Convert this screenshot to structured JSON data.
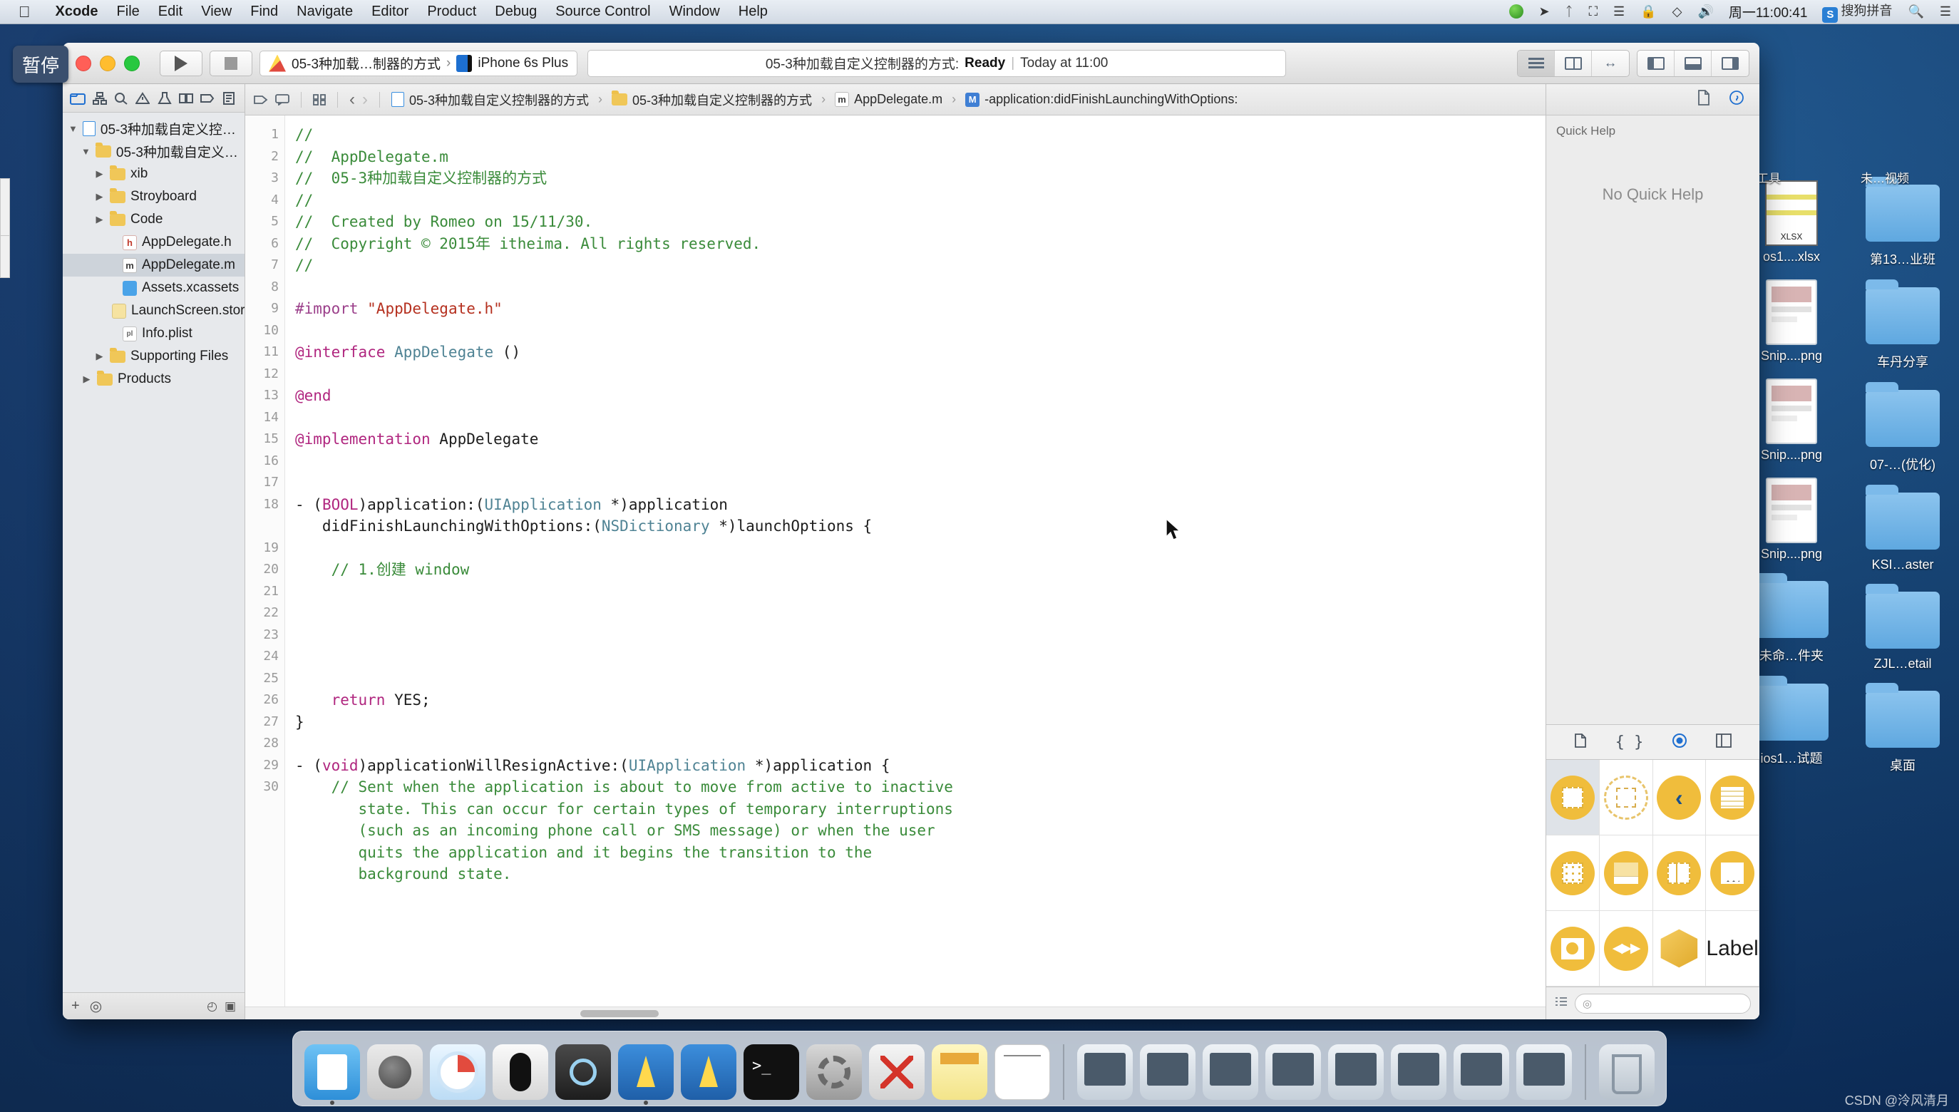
{
  "menubar": {
    "apple_icon": "apple-icon",
    "items": [
      "Xcode",
      "File",
      "Edit",
      "View",
      "Find",
      "Navigate",
      "Editor",
      "Product",
      "Debug",
      "Source Control",
      "Window",
      "Help"
    ],
    "app_name": "Xcode",
    "status_icons": [
      "screen-record-icon",
      "location-icon",
      "bluetooth-icon",
      "display-icon",
      "vpn-icon",
      "lock-icon",
      "dropbox-icon",
      "volume-icon"
    ],
    "clock": "周一11:00:41",
    "input_method": "搜狗拼音",
    "input_method_badge": "S",
    "search_icon": "search-icon",
    "notification_icon": "notification-center-icon"
  },
  "pause_chip": {
    "label": "暂停"
  },
  "xcode": {
    "toolbar": {
      "run_icon": "run-play-icon",
      "stop_icon": "stop-square-icon",
      "scheme_name": "05-3种加载…制器的方式",
      "scheme_separator": "›",
      "device_name": "iPhone 6s Plus",
      "status_project": "05-3种加载自定义控制器的方式:",
      "status_state": "Ready",
      "status_sep": "|",
      "status_time": "Today at 11:00",
      "editor_segments": [
        "standard-editor-icon",
        "assistant-editor-icon",
        "version-editor-icon"
      ],
      "view_segments": [
        "navigator-toggle-icon",
        "debug-area-toggle-icon",
        "utilities-toggle-icon"
      ]
    },
    "navigator": {
      "tabs": [
        "project-navigator-icon",
        "symbol-navigator-icon",
        "find-navigator-icon",
        "issue-navigator-icon",
        "test-navigator-icon",
        "debug-navigator-icon",
        "breakpoint-navigator-icon",
        "report-navigator-icon"
      ],
      "tree": [
        {
          "label": "05-3种加载自定义控制器的方式",
          "indent": 0,
          "twisty": "▼",
          "icon": "project-icon"
        },
        {
          "label": "05-3种加载自定义控制器的方式",
          "indent": 1,
          "twisty": "▼",
          "icon": "folder-icon"
        },
        {
          "label": "xib",
          "indent": 2,
          "twisty": "▶",
          "icon": "folder-icon"
        },
        {
          "label": "Stroyboard",
          "indent": 2,
          "twisty": "▶",
          "icon": "folder-icon"
        },
        {
          "label": "Code",
          "indent": 2,
          "twisty": "▶",
          "icon": "folder-icon"
        },
        {
          "label": "AppDelegate.h",
          "indent": 3,
          "twisty": "",
          "icon": "header-file-icon"
        },
        {
          "label": "AppDelegate.m",
          "indent": 3,
          "twisty": "",
          "icon": "implementation-file-icon",
          "selected": true
        },
        {
          "label": "Assets.xcassets",
          "indent": 3,
          "twisty": "",
          "icon": "assets-catalog-icon"
        },
        {
          "label": "LaunchScreen.storyboard",
          "indent": 3,
          "twisty": "",
          "icon": "storyboard-icon"
        },
        {
          "label": "Info.plist",
          "indent": 3,
          "twisty": "",
          "icon": "plist-icon"
        },
        {
          "label": "Supporting Files",
          "indent": 2,
          "twisty": "▶",
          "icon": "folder-icon"
        },
        {
          "label": "Products",
          "indent": 1,
          "twisty": "▶",
          "icon": "folder-icon"
        }
      ],
      "footer": {
        "add_label": "+",
        "filter_icon": "filter-icon",
        "recent_icon": "recent-files-icon",
        "sourcecontrol_icon": "source-control-filter-icon"
      }
    },
    "jumpbar": {
      "back_icon": "‹",
      "forward_icon": "›",
      "related_icon": "related-items-icon",
      "comment_icon": "comment-icon",
      "grid_icon": "scheme-grid-icon",
      "crumbs": [
        {
          "label": "05-3种加载自定义控制器的方式",
          "icon": "project-icon"
        },
        {
          "label": "05-3种加载自定义控制器的方式",
          "icon": "folder-icon"
        },
        {
          "label": "AppDelegate.m",
          "icon": "implementation-file-icon"
        },
        {
          "label": "-application:didFinishLaunchingWithOptions:",
          "icon": "method-badge-icon"
        }
      ]
    },
    "code": {
      "language": "Objective-C",
      "first_line": 1,
      "lines": [
        {
          "n": 1,
          "tokens": [
            {
              "t": "//",
              "c": "cm"
            }
          ]
        },
        {
          "n": 2,
          "tokens": [
            {
              "t": "//  AppDelegate.m",
              "c": "cm"
            }
          ]
        },
        {
          "n": 3,
          "tokens": [
            {
              "t": "//  05-3种加载自定义控制器的方式",
              "c": "cm"
            }
          ]
        },
        {
          "n": 4,
          "tokens": [
            {
              "t": "//",
              "c": "cm"
            }
          ]
        },
        {
          "n": 5,
          "tokens": [
            {
              "t": "//  Created by Romeo on 15/11/30.",
              "c": "cm"
            }
          ]
        },
        {
          "n": 6,
          "tokens": [
            {
              "t": "//  Copyright © 2015年 itheima. All rights reserved.",
              "c": "cm"
            }
          ]
        },
        {
          "n": 7,
          "tokens": [
            {
              "t": "//",
              "c": "cm"
            }
          ]
        },
        {
          "n": 8,
          "tokens": []
        },
        {
          "n": 9,
          "tokens": [
            {
              "t": "#import ",
              "c": "pp"
            },
            {
              "t": "\"AppDelegate.h\"",
              "c": "str"
            }
          ]
        },
        {
          "n": 10,
          "tokens": []
        },
        {
          "n": 11,
          "tokens": [
            {
              "t": "@interface ",
              "c": "kw"
            },
            {
              "t": "AppDelegate",
              "c": "ty"
            },
            {
              "t": " ()",
              "c": "id"
            }
          ]
        },
        {
          "n": 12,
          "tokens": []
        },
        {
          "n": 13,
          "tokens": [
            {
              "t": "@end",
              "c": "kw"
            }
          ]
        },
        {
          "n": 14,
          "tokens": []
        },
        {
          "n": 15,
          "tokens": [
            {
              "t": "@implementation ",
              "c": "kw"
            },
            {
              "t": "AppDelegate",
              "c": "id"
            }
          ]
        },
        {
          "n": 16,
          "tokens": []
        },
        {
          "n": 17,
          "tokens": []
        },
        {
          "n": 18,
          "tokens": [
            {
              "t": "- (",
              "c": "id"
            },
            {
              "t": "BOOL",
              "c": "kw"
            },
            {
              "t": ")application:(",
              "c": "id"
            },
            {
              "t": "UIApplication",
              "c": "ty"
            },
            {
              "t": " *)application",
              "c": "id"
            }
          ]
        },
        {
          "n": "",
          "tokens": [
            {
              "t": "   didFinishLaunchingWithOptions:(",
              "c": "id"
            },
            {
              "t": "NSDictionary",
              "c": "ty"
            },
            {
              "t": " *)launchOptions {",
              "c": "id"
            }
          ]
        },
        {
          "n": 19,
          "tokens": []
        },
        {
          "n": 20,
          "tokens": [
            {
              "t": "    // 1.创建 window",
              "c": "cm"
            }
          ]
        },
        {
          "n": 21,
          "tokens": []
        },
        {
          "n": 22,
          "tokens": []
        },
        {
          "n": 23,
          "tokens": []
        },
        {
          "n": 24,
          "tokens": []
        },
        {
          "n": 25,
          "tokens": []
        },
        {
          "n": 26,
          "tokens": [
            {
              "t": "    ",
              "c": "id"
            },
            {
              "t": "return",
              "c": "kw"
            },
            {
              "t": " YES;",
              "c": "id"
            }
          ]
        },
        {
          "n": 27,
          "tokens": [
            {
              "t": "}",
              "c": "id"
            }
          ]
        },
        {
          "n": 28,
          "tokens": []
        },
        {
          "n": 29,
          "tokens": [
            {
              "t": "- (",
              "c": "id"
            },
            {
              "t": "void",
              "c": "kw"
            },
            {
              "t": ")applicationWillResignActive:(",
              "c": "id"
            },
            {
              "t": "UIApplication",
              "c": "ty"
            },
            {
              "t": " *)application {",
              "c": "id"
            }
          ]
        },
        {
          "n": 30,
          "tokens": [
            {
              "t": "    // Sent when the application is about to move from active to inactive",
              "c": "cm"
            }
          ]
        },
        {
          "n": "",
          "tokens": [
            {
              "t": "       state. This can occur for certain types of temporary interruptions",
              "c": "cm"
            }
          ]
        },
        {
          "n": "",
          "tokens": [
            {
              "t": "       (such as an incoming phone call or SMS message) or when the user",
              "c": "cm"
            }
          ]
        },
        {
          "n": "",
          "tokens": [
            {
              "t": "       quits the application and it begins the transition to the",
              "c": "cm"
            }
          ]
        },
        {
          "n": "",
          "tokens": [
            {
              "t": "       background state.",
              "c": "cm"
            }
          ]
        }
      ]
    },
    "utilities": {
      "tabs": [
        "file-inspector-icon",
        "quick-help-inspector-icon"
      ],
      "quick_help_title": "Quick Help",
      "quick_help_empty": "No Quick Help",
      "library_tabs": [
        "file-template-library-icon",
        "code-snippet-library-icon",
        "object-library-icon",
        "media-library-icon"
      ],
      "library_active_tab_index": 2,
      "objects": [
        {
          "name": "View Controller",
          "icon": "view-controller-icon",
          "selected": true
        },
        {
          "name": "Storyboard Reference",
          "icon": "storyboard-reference-icon"
        },
        {
          "name": "Navigation Controller",
          "icon": "navigation-controller-icon"
        },
        {
          "name": "Table View Controller",
          "icon": "table-view-controller-icon"
        },
        {
          "name": "Collection View Controller",
          "icon": "collection-view-controller-icon"
        },
        {
          "name": "Tab Bar Controller",
          "icon": "tab-bar-controller-icon"
        },
        {
          "name": "Split View Controller",
          "icon": "split-view-controller-icon"
        },
        {
          "name": "Page View Controller",
          "icon": "page-view-controller-icon"
        },
        {
          "name": "GLKit View Controller",
          "icon": "glkit-view-controller-icon"
        },
        {
          "name": "AVKit Player View Controller",
          "icon": "avkit-player-icon"
        },
        {
          "name": "Object",
          "icon": "object-cube-icon"
        },
        {
          "name": "Label",
          "icon": "label-text-icon",
          "text": "Label"
        }
      ],
      "search_placeholder": "",
      "search_icon": "search-icon",
      "list_view_icon": "list-view-icon"
    }
  },
  "desktop": {
    "column_right_inner": [
      {
        "label": "os1....xlsx",
        "icon": "xlsx-file-icon"
      },
      {
        "label": "Snip....png",
        "icon": "png-file-icon"
      },
      {
        "label": "Snip....png",
        "icon": "png-file-icon"
      },
      {
        "label": "Snip....png",
        "icon": "png-file-icon"
      },
      {
        "label": "未命…件夹",
        "icon": "folder-icon"
      },
      {
        "label": "ios1…试题",
        "icon": "folder-icon"
      }
    ],
    "column_right_outer": [
      {
        "label": "第13…业班",
        "icon": "folder-icon"
      },
      {
        "label": "车丹分享",
        "icon": "folder-icon"
      },
      {
        "label": "07-…(优化)",
        "icon": "folder-icon"
      },
      {
        "label": "KSI…aster",
        "icon": "folder-icon"
      },
      {
        "label": "ZJL…etail",
        "icon": "folder-icon"
      },
      {
        "label": "桌面",
        "icon": "folder-icon"
      }
    ],
    "top_right_labels": [
      "开发工具",
      "未…视频"
    ]
  },
  "dock": {
    "items": [
      {
        "name": "Finder",
        "icon": "finder-icon",
        "running": true
      },
      {
        "name": "Launchpad",
        "icon": "launchpad-icon",
        "running": false
      },
      {
        "name": "Safari",
        "icon": "safari-icon",
        "running": false
      },
      {
        "name": "Mouse",
        "icon": "mouse-utility-icon",
        "running": false
      },
      {
        "name": "QuickTime Player",
        "icon": "quicktime-icon",
        "running": false
      },
      {
        "name": "Xcode",
        "icon": "xcode-icon",
        "running": true
      },
      {
        "name": "Xcode Beta",
        "icon": "xcode-beta-icon",
        "running": false
      },
      {
        "name": "Terminal",
        "icon": "terminal-icon",
        "running": false
      },
      {
        "name": "System Preferences",
        "icon": "system-preferences-icon",
        "running": false
      },
      {
        "name": "XMind",
        "icon": "xmind-icon",
        "running": false
      },
      {
        "name": "Notes",
        "icon": "notes-icon",
        "running": false
      },
      {
        "name": "TextEdit",
        "icon": "textedit-icon",
        "running": false
      },
      {
        "name": "Screen 1",
        "icon": "screen-icon",
        "running": false
      },
      {
        "name": "Screen 2",
        "icon": "screen-icon",
        "running": false
      },
      {
        "name": "Screen 3",
        "icon": "screen-icon",
        "running": false
      },
      {
        "name": "Screen 4",
        "icon": "screen-icon",
        "running": false
      },
      {
        "name": "Screen 5",
        "icon": "screen-icon",
        "running": false
      },
      {
        "name": "Screen 6",
        "icon": "screen-icon",
        "running": false
      },
      {
        "name": "Screen 7",
        "icon": "screen-icon",
        "running": false
      },
      {
        "name": "Screen 8",
        "icon": "screen-icon",
        "running": false
      },
      {
        "name": "Trash",
        "icon": "trash-icon",
        "running": false
      }
    ]
  },
  "watermark": "CSDN @泠风清月",
  "colors": {
    "accent_blue": "#1f6fd0",
    "comment_green": "#3a8b3a",
    "string_red": "#b5301f",
    "keyword_magenta": "#b0267f",
    "type_teal": "#4f8394",
    "preprocessor_purple": "#9b3f8a",
    "object_yellow": "#f0bd3c",
    "desktop_blue": "#15487f"
  }
}
